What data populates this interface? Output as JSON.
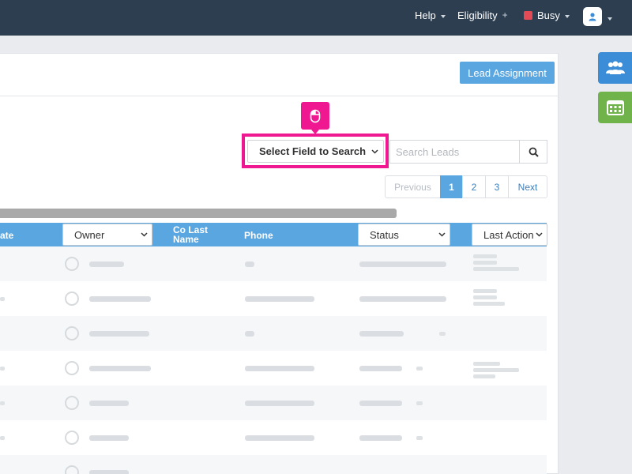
{
  "topbar": {
    "help": "Help",
    "eligibility": "Eligibility",
    "eligibility_symbol": "+",
    "status": "Busy",
    "status_color": "#e24b55",
    "bg_color": "#2d3e50"
  },
  "panel": {
    "lead_assignment": "Lead Assignment"
  },
  "search": {
    "field_select": "Select Field to Search",
    "placeholder": "Search Leads",
    "highlight_color": "#f01890"
  },
  "pagination": {
    "previous": "Previous",
    "pages": [
      "1",
      "2",
      "3"
    ],
    "active_page": "1",
    "next": "Next"
  },
  "table": {
    "accent": "#5aa6e0",
    "columns": {
      "date_fragment": "ate",
      "owner": "Owner",
      "co_last_name": "Co Last Name",
      "phone": "Phone",
      "status": "Status",
      "last_action": "Last Action"
    },
    "row_count": 7
  },
  "icons": [
    "mouse-icon",
    "search-icon",
    "users-icon",
    "calendar-icon",
    "user-avatar-icon",
    "chevron-down-icon"
  ]
}
